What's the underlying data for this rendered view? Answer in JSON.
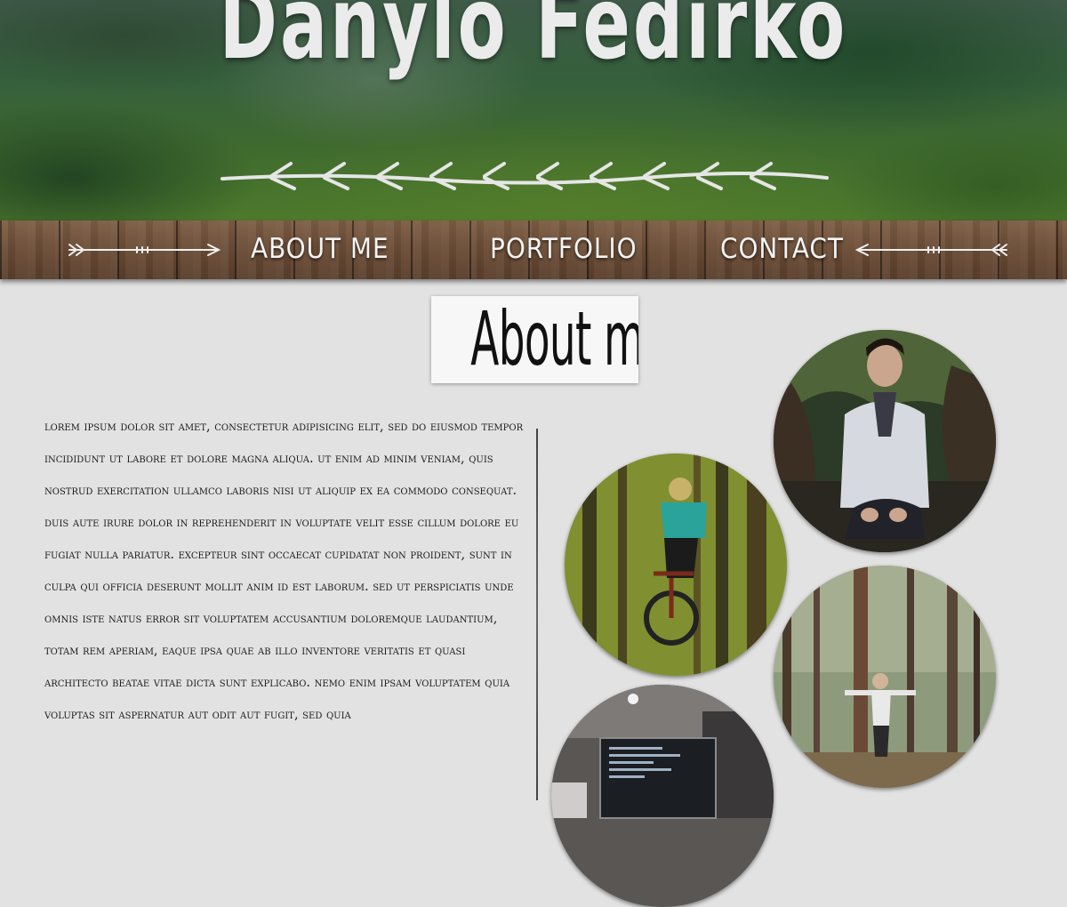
{
  "header": {
    "title": "Danylo Fedirko"
  },
  "nav": {
    "items": [
      {
        "label": "About me"
      },
      {
        "label": "Portfolio"
      },
      {
        "label": "Contact"
      }
    ]
  },
  "section": {
    "heading": "About me",
    "paragraph": "Lorem ipsum dolor sit amet, consectetur adipisicing elit, sed do eiusmod tempor incididunt ut labore et dolore magna aliqua. Ut enim ad minim veniam, quis nostrud exercitation ullamco laboris nisi ut aliquip ex ea commodo consequat. Duis aute irure dolor in reprehenderit in voluptate velit esse cillum dolore eu fugiat nulla pariatur. Excepteur sint occaecat cupidatat non proident, sunt in culpa qui officia deserunt mollit anim id est laborum. Sed ut perspiciatis unde omnis iste natus error sit voluptatem accusantium doloremque laudantium, totam rem aperiam, eaque ipsa quae ab illo inventore veritatis et quasi architecto beatae vitae dicta sunt explicabo. Nemo enim ipsam voluptatem quia voluptas sit aspernatur aut odit aut fugit, sed quia"
  },
  "colors": {
    "page_background": "#e2e2e2",
    "wood": "#6a4c36",
    "hero_green": "#3f6a2f",
    "heading_box": "#f8f7f7"
  }
}
